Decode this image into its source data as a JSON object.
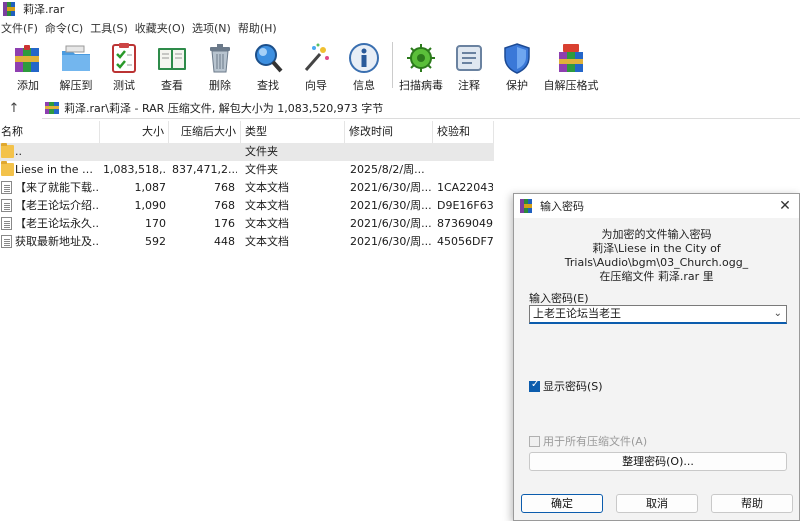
{
  "window": {
    "title": "莉泽.rar"
  },
  "menu": [
    "文件(F)",
    "命令(C)",
    "工具(S)",
    "收藏夹(O)",
    "选项(N)",
    "帮助(H)"
  ],
  "toolbar": [
    {
      "label": "添加",
      "icon": "add-archive-icon"
    },
    {
      "label": "解压到",
      "icon": "extract-to-folder-icon"
    },
    {
      "label": "测试",
      "icon": "test-checklist-icon"
    },
    {
      "label": "查看",
      "icon": "view-book-icon"
    },
    {
      "label": "删除",
      "icon": "trash-icon"
    },
    {
      "label": "查找",
      "icon": "search-magnifier-icon"
    },
    {
      "label": "向导",
      "icon": "wizard-wand-icon"
    },
    {
      "label": "信息",
      "icon": "info-icon"
    },
    {
      "label": "扫描病毒",
      "icon": "virus-scan-icon"
    },
    {
      "label": "注释",
      "icon": "comment-icon"
    },
    {
      "label": "保护",
      "icon": "shield-icon"
    },
    {
      "label": "自解压格式",
      "icon": "sfx-archive-icon"
    }
  ],
  "address": {
    "text": "莉泽.rar\\莉泽 - RAR 压缩文件, 解包大小为 1,083,520,973 字节"
  },
  "columns": [
    "名称",
    "大小",
    "压缩后大小",
    "类型",
    "修改时间",
    "校验和"
  ],
  "files": [
    {
      "name": "..",
      "size": "",
      "packed": "",
      "type": "文件夹",
      "modified": "",
      "crc": "",
      "kind": "folder"
    },
    {
      "name": "Liese in the City of Trials",
      "size": "1,083,518,...",
      "packed": "837,471,2...",
      "type": "文件夹",
      "modified": "2025/8/2/周...",
      "crc": "",
      "kind": "folder"
    },
    {
      "name": "【来了就能下载...",
      "size": "1,087",
      "packed": "768",
      "type": "文本文档",
      "modified": "2021/6/30/周...",
      "crc": "1CA22043",
      "kind": "doc"
    },
    {
      "name": "【老王论坛介绍...",
      "size": "1,090",
      "packed": "768",
      "type": "文本文档",
      "modified": "2021/6/30/周...",
      "crc": "D9E16F63",
      "kind": "doc"
    },
    {
      "name": "【老王论坛永久...",
      "size": "170",
      "packed": "176",
      "type": "文本文档",
      "modified": "2021/6/30/周...",
      "crc": "87369049",
      "kind": "doc"
    },
    {
      "name": "获取最新地址及...",
      "size": "592",
      "packed": "448",
      "type": "文本文档",
      "modified": "2021/6/30/周...",
      "crc": "45056DF7",
      "kind": "doc"
    }
  ],
  "dialog": {
    "title": "输入密码",
    "info_line1": "为加密的文件输入密码",
    "info_line2": "莉泽\\Liese in the City of Trials\\Audio\\bgm\\03_Church.ogg_",
    "info_line3": "在压缩文件 莉泽.rar 里",
    "password_label": "输入密码(E)",
    "password_value": "上老王论坛当老王",
    "show_password_label": "显示密码(S)",
    "show_password_checked": true,
    "use_for_all_label": "用于所有压缩文件(A)",
    "use_for_all_checked": false,
    "organize_button": "整理密码(O)...",
    "ok_button": "确定",
    "cancel_button": "取消",
    "help_button": "帮助"
  }
}
